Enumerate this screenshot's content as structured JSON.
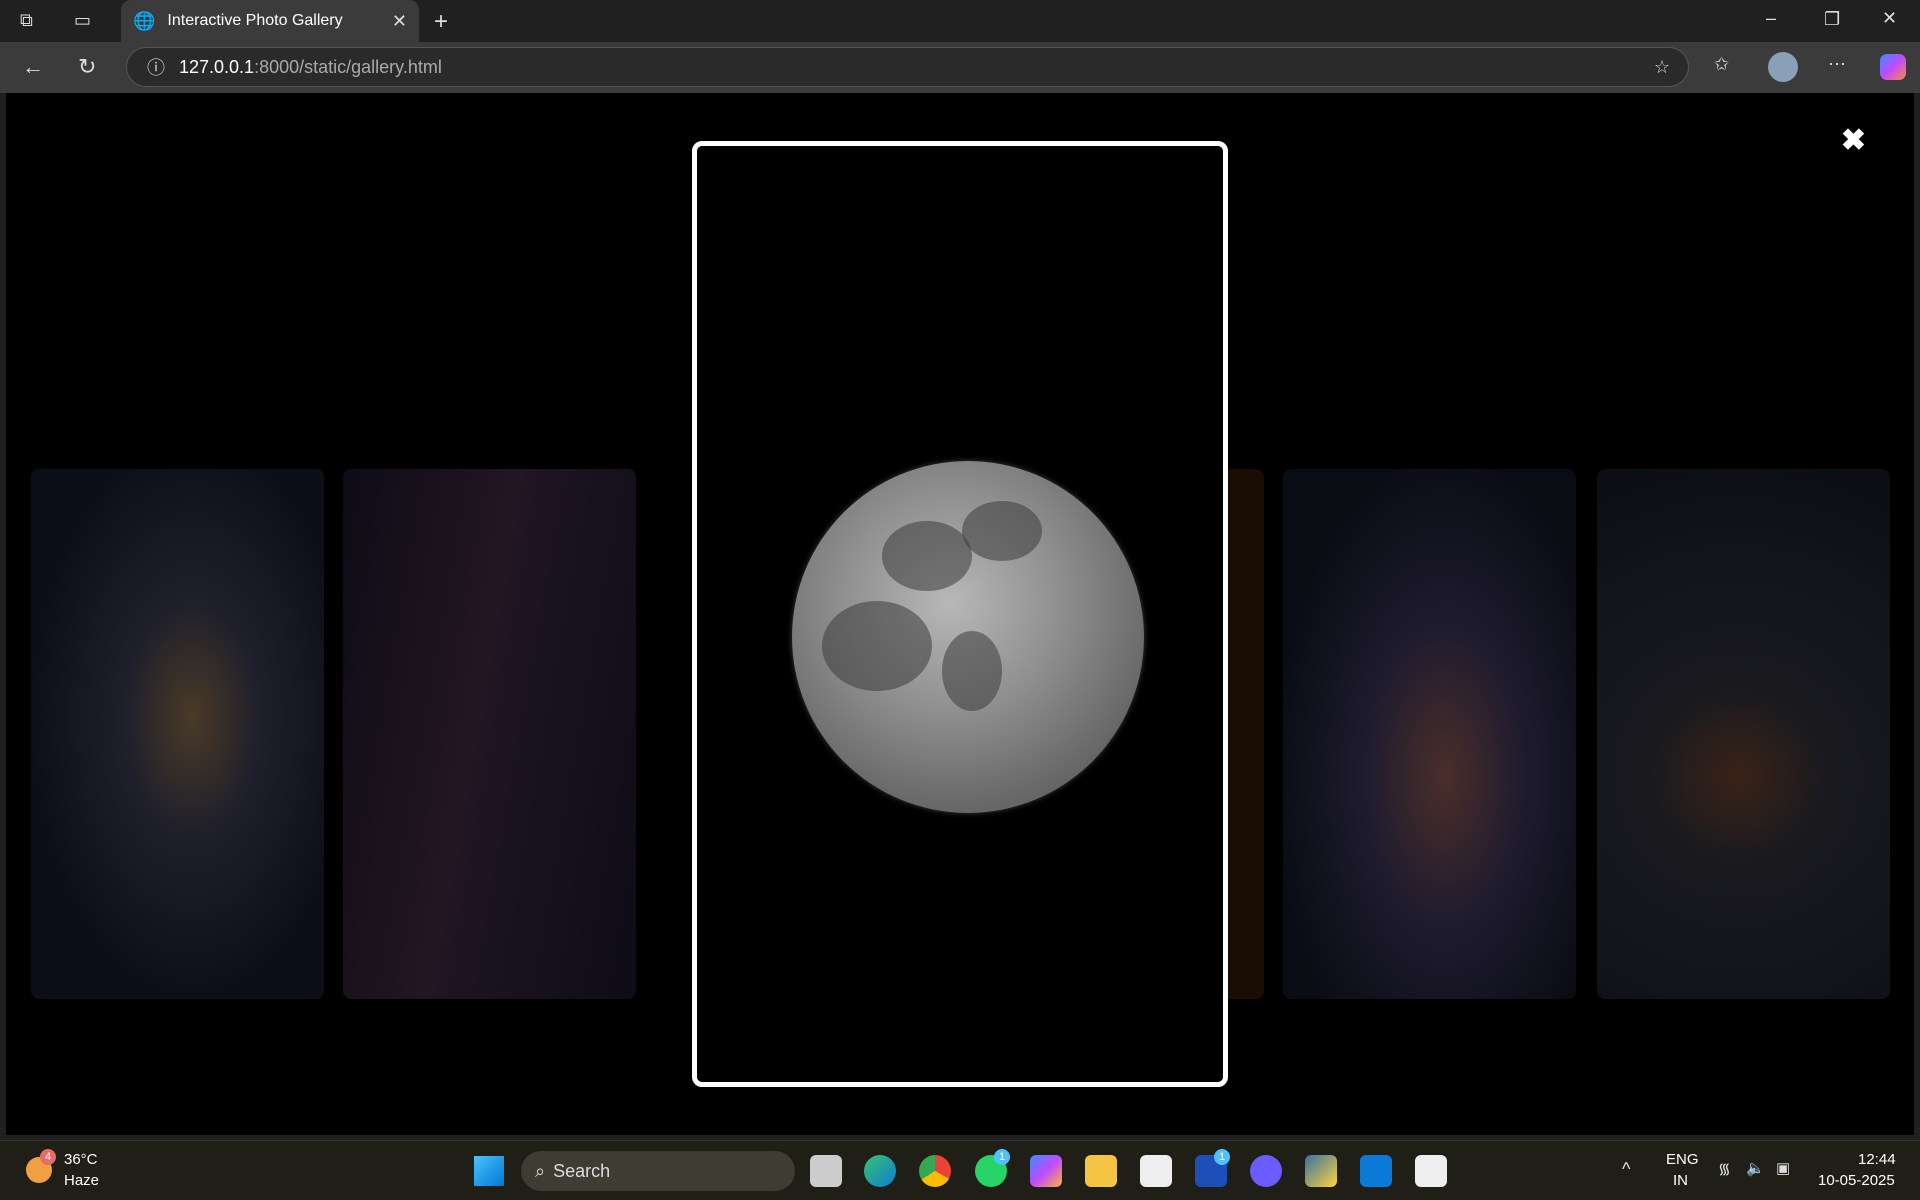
{
  "browser": {
    "tab_title": "Interactive Photo Gallery",
    "url_host": "127.0.0.1",
    "url_path": ":8000/static/gallery.html"
  },
  "gallery": {
    "close_label": "✖",
    "images": [
      "galaxy",
      "milky-way",
      "orange",
      "rocket-galaxy",
      "asteroid"
    ],
    "active_image": "moon"
  },
  "taskbar": {
    "weather_temp": "36°C",
    "weather_desc": "Haze",
    "weather_badge": "4",
    "search_label": "Search",
    "whatsapp_badge": "1",
    "l_badge": "1",
    "lang_top": "ENG",
    "lang_bottom": "IN",
    "time": "12:44",
    "date": "10-05-2025"
  }
}
